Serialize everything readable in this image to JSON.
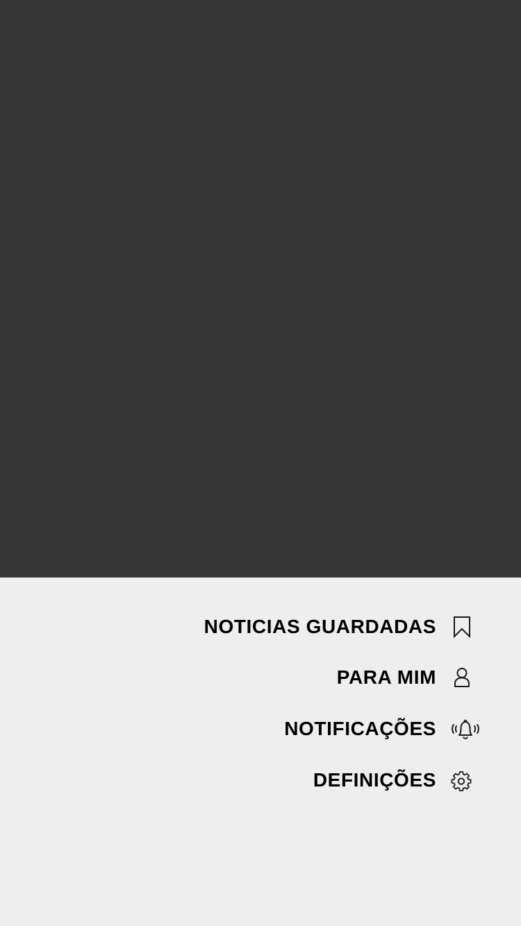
{
  "menu": {
    "items": [
      {
        "label": "NOTICIAS GUARDADAS",
        "icon": "bookmark-icon"
      },
      {
        "label": "PARA MIM",
        "icon": "user-icon"
      },
      {
        "label": "NOTIFICAÇÕES",
        "icon": "bell-ringing-icon"
      },
      {
        "label": "DEFINIÇÕES",
        "icon": "gear-icon"
      }
    ]
  },
  "colors": {
    "overlay": "#373737",
    "sheet_background": "#eeeeee",
    "text": "#000000",
    "icon_stroke": "#1a1a1a"
  }
}
